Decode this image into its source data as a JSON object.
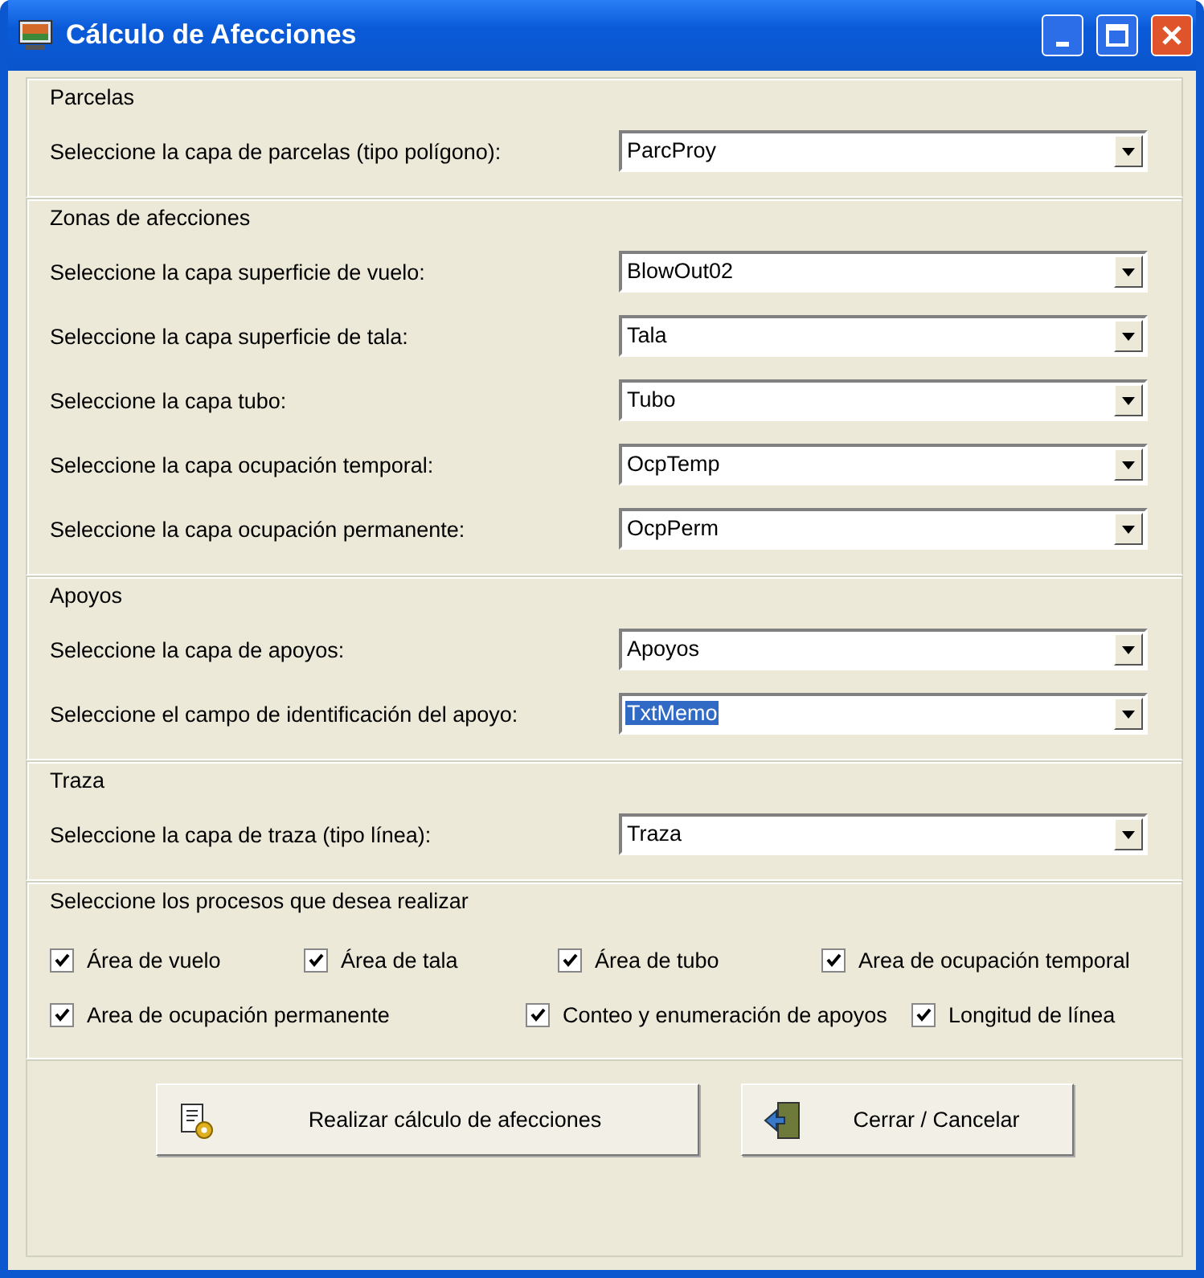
{
  "window": {
    "title": "Cálculo de Afecciones"
  },
  "groups": [
    {
      "title": "Parcelas",
      "rows": [
        {
          "label": "Seleccione la capa de parcelas (tipo polígono):",
          "value": "ParcProy",
          "selected": false
        }
      ]
    },
    {
      "title": "Zonas de afecciones",
      "rows": [
        {
          "label": "Seleccione la capa superficie de vuelo:",
          "value": "BlowOut02",
          "selected": false
        },
        {
          "label": "Seleccione la capa superficie de tala:",
          "value": "Tala",
          "selected": false
        },
        {
          "label": "Seleccione la capa tubo:",
          "value": "Tubo",
          "selected": false
        },
        {
          "label": "Seleccione la capa ocupación temporal:",
          "value": "OcpTemp",
          "selected": false
        },
        {
          "label": "Seleccione la capa ocupación permanente:",
          "value": "OcpPerm",
          "selected": false
        }
      ]
    },
    {
      "title": "Apoyos",
      "rows": [
        {
          "label": "Seleccione la capa de apoyos:",
          "value": "Apoyos",
          "selected": false
        },
        {
          "label": "Seleccione el campo de identificación del apoyo:",
          "value": "TxtMemo",
          "selected": true
        }
      ]
    },
    {
      "title": "Traza",
      "rows": [
        {
          "label": "Seleccione la capa de traza (tipo línea):",
          "value": "Traza",
          "selected": false
        }
      ]
    }
  ],
  "processes": {
    "title": "Seleccione los procesos que desea realizar",
    "items": [
      {
        "label": "Área de vuelo",
        "checked": true
      },
      {
        "label": "Área de tala",
        "checked": true
      },
      {
        "label": "Área de tubo",
        "checked": true
      },
      {
        "label": "Area de ocupación temporal",
        "checked": true
      },
      {
        "label": "Area de ocupación permanente",
        "checked": true
      },
      {
        "label": "Conteo y enumeración de apoyos",
        "checked": true
      },
      {
        "label": "Longitud de línea",
        "checked": true
      }
    ]
  },
  "buttons": [
    {
      "kind": "run",
      "label": "Realizar cálculo de afecciones"
    },
    {
      "kind": "close",
      "label": "Cerrar / Cancelar"
    }
  ]
}
